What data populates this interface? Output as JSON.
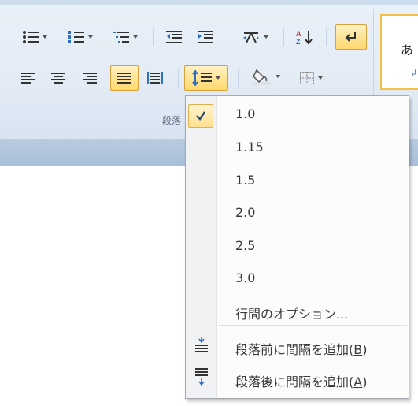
{
  "ribbon": {
    "group_label": "段落",
    "style_preview_char": "あ",
    "style_preview_return": "↲"
  },
  "line_spacing_menu": {
    "selected": "1.0",
    "items": [
      {
        "label": "1.0",
        "checked": true
      },
      {
        "label": "1.15"
      },
      {
        "label": "1.5"
      },
      {
        "label": "2.0"
      },
      {
        "label": "2.5"
      },
      {
        "label": "3.0"
      },
      {
        "label": "行間のオプション..."
      }
    ],
    "add_before_prefix": "段落前に間隔を追加(",
    "add_before_key": "B",
    "add_before_suffix": ")",
    "add_after_prefix": "段落後に間隔を追加(",
    "add_after_key": "A",
    "add_after_suffix": ")"
  },
  "colors": {
    "active_bg": "#ffd86d",
    "active_border": "#d7a23a",
    "icon_blue": "#2f6fc0"
  }
}
